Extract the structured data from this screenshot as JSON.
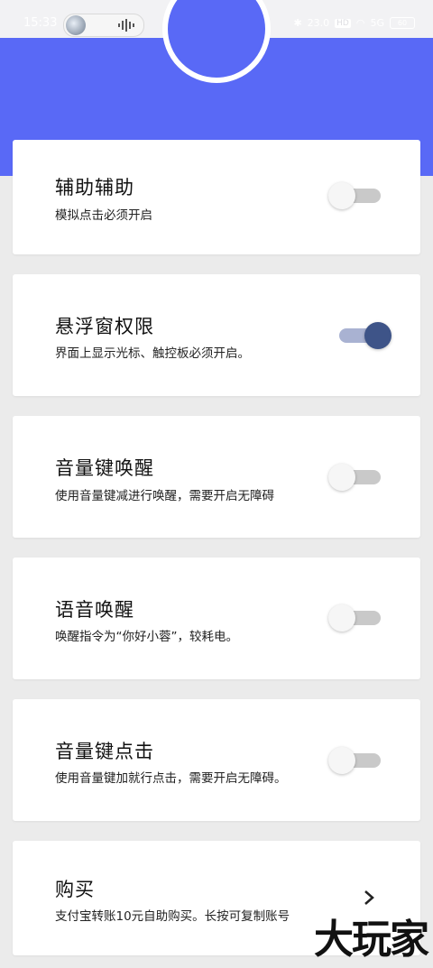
{
  "status_bar": {
    "time": "15:33",
    "network_speed": "23.0",
    "network_unit": "KB/S",
    "hd_badge": "HD",
    "signal_label": "5G",
    "battery": "60"
  },
  "settings": [
    {
      "title": "辅助辅助",
      "description": "模拟点击必须开启",
      "enabled": false
    },
    {
      "title": "悬浮窗权限",
      "description": "界面上显示光标、触控板必须开启。",
      "enabled": true
    },
    {
      "title": "音量键唤醒",
      "description": "使用音量键减进行唤醒，需要开启无障碍",
      "enabled": false
    },
    {
      "title": "语音唤醒",
      "description": "唤醒指令为“你好小蓉”，较耗电。",
      "enabled": false
    },
    {
      "title": "音量键点击",
      "description": "使用音量键加就行点击，需要开启无障碍。",
      "enabled": false
    }
  ],
  "purchase": {
    "title": "购买",
    "description": "支付宝转账10元自助购买。长按可复制账号"
  },
  "watermark": "大玩家",
  "colors": {
    "accent": "#5969f6",
    "toggle_on": "#3e5488",
    "card": "#ffffff",
    "page_bg": "#ebebeb"
  }
}
